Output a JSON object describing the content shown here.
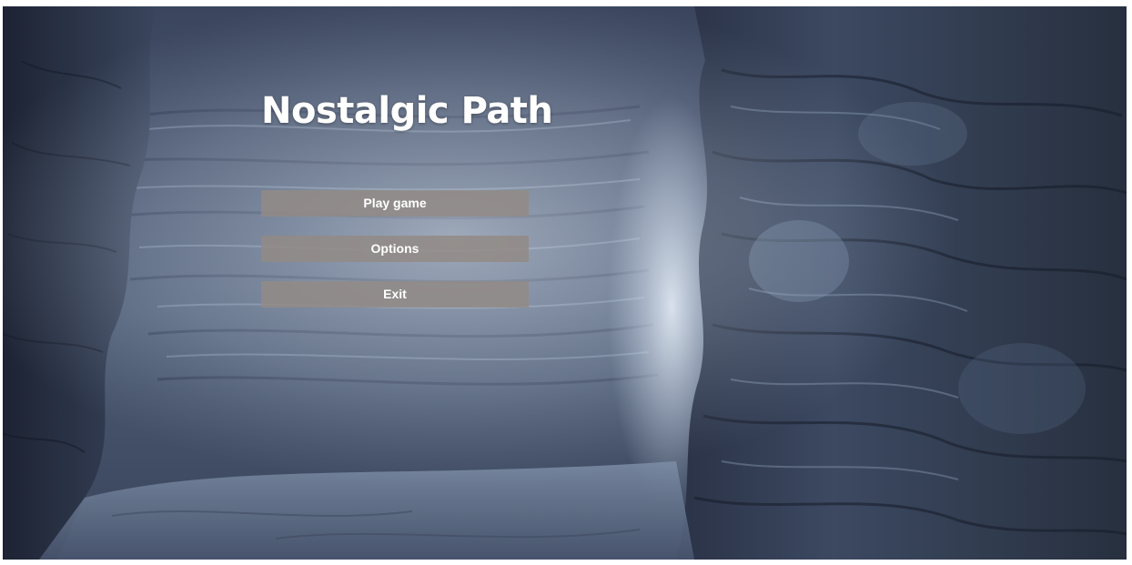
{
  "game": {
    "title": "Nostalgic Path"
  },
  "menu": {
    "items": [
      {
        "label": "Play game"
      },
      {
        "label": "Options"
      },
      {
        "label": "Exit"
      }
    ]
  },
  "background": {
    "scene": "rocky-canyon-cave",
    "colors": {
      "rock_dark": "#1f2638",
      "rock_mid": "#3e4c66",
      "rock_light": "#8fa2bd",
      "fog": "#dde8f4",
      "button_fill": "#928a86"
    }
  }
}
